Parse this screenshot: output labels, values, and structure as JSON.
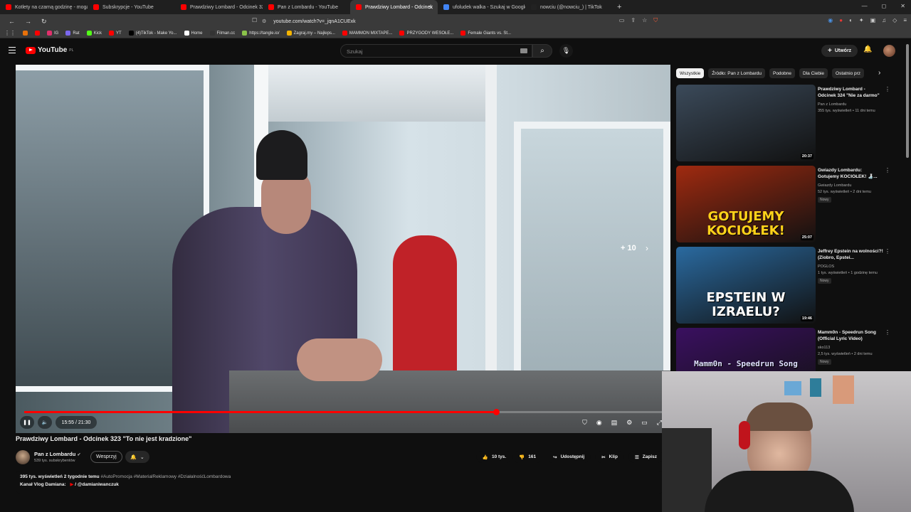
{
  "browser": {
    "tabs": [
      {
        "label": "Kotlety na czarną godzinę - mogą st",
        "color": "#ff0000",
        "active": false
      },
      {
        "label": "Subskrypcje - YouTube",
        "color": "#ff0000",
        "active": false
      },
      {
        "label": "Prawdziwy Lombard - Odcinek 327",
        "color": "#ff0000",
        "active": false
      },
      {
        "label": "Pan z Lombardu - YouTube",
        "color": "#ff0000",
        "active": false
      },
      {
        "label": "Prawdziwy Lombard - Odcinek",
        "color": "#ff0000",
        "active": true
      },
      {
        "label": "ufoludek walka - Szukaj w Google",
        "color": "#4285f4",
        "active": false
      },
      {
        "label": "nowciu (@nowciu_) | TikTok",
        "color": "#222222",
        "active": false
      }
    ],
    "new_tab": "+",
    "window_controls": [
      "—",
      "◻",
      "✕"
    ],
    "url": "youtube.com/watch?v=_jqnA1CUExk",
    "bookmarks": [
      {
        "label": "",
        "color": "#e8710a"
      },
      {
        "label": "",
        "color": "#ff0000"
      },
      {
        "label": "IG",
        "color": "#e1306c"
      },
      {
        "label": "Rat",
        "color": "#7b68ee"
      },
      {
        "label": "Kick",
        "color": "#53fc18"
      },
      {
        "label": "YT",
        "color": "#ff0000"
      },
      {
        "label": "(4)TikTok - Make Yo...",
        "color": "#000000"
      },
      {
        "label": "Home",
        "color": "#ffffff"
      },
      {
        "label": "Filman.cc",
        "color": "#333333"
      },
      {
        "label": "https://tangle.io/",
        "color": "#8bc34a"
      },
      {
        "label": "Zagraj.my – Najleps...",
        "color": "#f4b400"
      },
      {
        "label": "MAMMON MIXTAPE...",
        "color": "#ff0000"
      },
      {
        "label": "PRZYGODY WESOŁE...",
        "color": "#ff0000"
      },
      {
        "label": "Female Giants vs. St...",
        "color": "#ff0000"
      }
    ]
  },
  "youtube": {
    "logo_text": "YouTube",
    "logo_region": "PL",
    "search_placeholder": "Szukaj",
    "create_label": "Utwórz",
    "player": {
      "time": "15:55 / 21:30",
      "progress": 0.74,
      "skip_label": "+ 10"
    },
    "video": {
      "title": "Prawdziwy Lombard - Odcinek 323 \"To nie jest kradzione\"",
      "channel": "Pan z Lombardu",
      "subscribers": "539 tys. subskrybentów",
      "support_label": "Wesprzyj",
      "likes": "10 tys.",
      "dislikes": "161",
      "share_label": "Udostępnij",
      "clip_label": "Klip",
      "save_label": "Zapisz",
      "stats": "395 tys. wyświetleń  2 tygodnie temu",
      "hashtags": "#AutoPromocja #MaterialReklamowy #DziałalnośćLombardowa",
      "desc_line2": "Kanał Vlog Damiana:",
      "desc_link": "@damianiwanczuk"
    },
    "chips": [
      "Wszystkie",
      "Źródło: Pan z Lombardu",
      "Podobne",
      "Dla Ciebie",
      "Ostatnio prz"
    ],
    "recommendations": [
      {
        "title": "Prawdziwy Lombard - Odcinek 324 \"Nie za darmo\"",
        "channel": "Pan z Lombardu",
        "meta": "355 tys. wyświetleń • 11 dni temu",
        "duration": "20:37",
        "badge": "",
        "overlay": "",
        "bg": "#3b4a5a"
      },
      {
        "title": "Gwiazdy Lombardu: Gotujemy KOCIOŁEK! 🍶...",
        "channel": "Gwiazdy Lombardu",
        "meta": "52 tys. wyświetleń • 2 dni temu",
        "duration": "25:07",
        "badge": "Nowy",
        "overlay": "GOTUJEMY KOCIOŁEK!",
        "bg": "#a02a10"
      },
      {
        "title": "Jeffrey Epstein na wolności?! (Ziobro, Epstei...",
        "channel": "POGLOS",
        "meta": "1 tys. wyświetleń • 1 godzinę temu",
        "duration": "19:46",
        "badge": "Nowy",
        "overlay": "EPSTEIN W IZRAELU?",
        "bg": "#2a6aa0"
      },
      {
        "title": "Mamm0n - Speedrun Song (Official Lyric Video)",
        "channel": "sko113",
        "meta": "2,5 tys. wyświetleń • 2 dni temu",
        "duration": "",
        "badge": "Nowy",
        "overlay": "Mamm0n - Speedrun Song",
        "bg": "#3a1060"
      }
    ]
  }
}
